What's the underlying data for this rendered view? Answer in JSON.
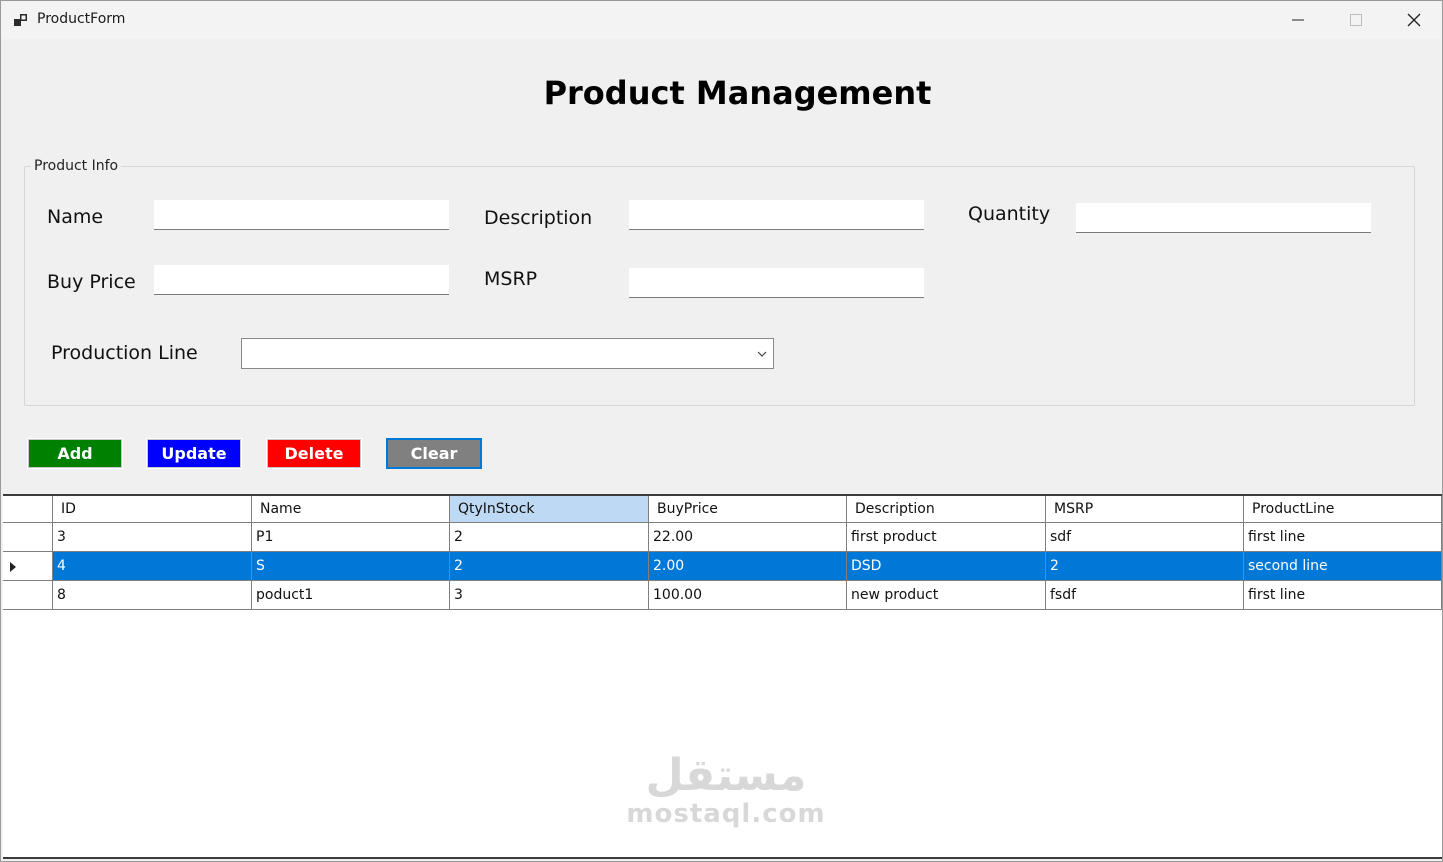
{
  "window": {
    "title": "ProductForm",
    "icon": "app-form-icon",
    "controls": [
      "minimize-icon",
      "maximize-icon",
      "close-icon"
    ]
  },
  "heading": "Product Management",
  "group": {
    "legend": "Product Info",
    "name_label": "Name",
    "name_value": "",
    "description_label": "Description",
    "description_value": "",
    "quantity_label": "Quantity",
    "quantity_value": "",
    "buy_price_label": "Buy Price",
    "buy_price_value": "",
    "msrp_label": "MSRP",
    "msrp_value": "",
    "production_line_label": "Production Line",
    "production_line_value": ""
  },
  "buttons": {
    "add": "Add",
    "update": "Update",
    "delete": "Delete",
    "clear": "Clear"
  },
  "colors": {
    "add": "#008000",
    "update": "#0000ff",
    "delete": "#ff0000",
    "clear": "#808080",
    "selection": "#0078d7",
    "sorted_header": "#bdd9f3"
  },
  "grid": {
    "columns": [
      "ID",
      "Name",
      "QtyInStock",
      "BuyPrice",
      "Description",
      "MSRP",
      "ProductLine"
    ],
    "selected_column": "QtyInStock",
    "selected_row_index": 1,
    "rows": [
      [
        "3",
        "P1",
        "2",
        "22.00",
        "first product",
        "sdf",
        "first line"
      ],
      [
        "4",
        "S",
        "2",
        "2.00",
        "DSD",
        "2",
        "second line"
      ],
      [
        "8",
        "poduct1",
        "3",
        "100.00",
        "new product",
        "fsdf",
        "first line"
      ]
    ]
  },
  "watermark": {
    "arabic": "مستقل",
    "latin": "mostaql.com"
  }
}
